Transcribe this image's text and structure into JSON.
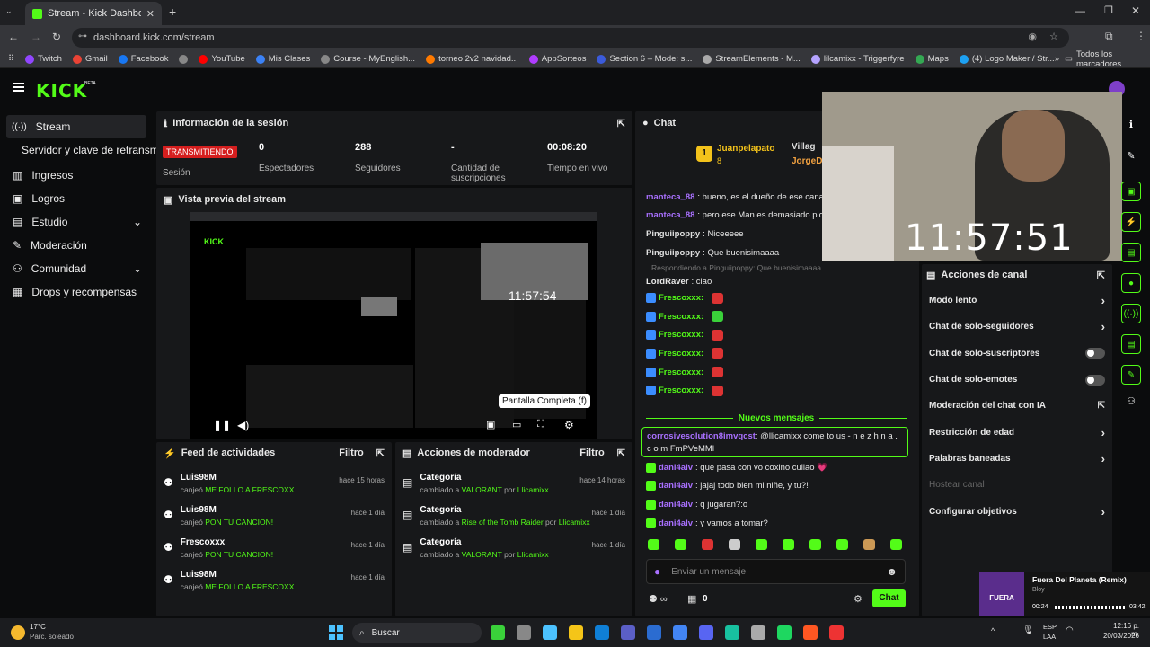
{
  "browser": {
    "tab_title": "Stream - Kick Dashboard",
    "url": "dashboard.kick.com/stream",
    "bookmarks": [
      "Twitch",
      "Gmail",
      "Facebook",
      "",
      "YouTube",
      "Mis Clases",
      "Course - MyEnglish...",
      "torneo 2v2 navidad...",
      "AppSorteos",
      "Section 6 – Mode: s...",
      "StreamElements - M...",
      "lilcamixx - Triggerfyre",
      "Maps",
      "(4) Logo Maker / Str..."
    ],
    "all_bookmarks": "Todos los marcadores"
  },
  "brand": {
    "logo": "KICK",
    "beta": "BETA"
  },
  "sidebar": {
    "items": [
      {
        "label": "Stream"
      },
      {
        "label": "Servidor y clave de retransmi"
      },
      {
        "label": "Ingresos"
      },
      {
        "label": "Logros"
      },
      {
        "label": "Estudio"
      },
      {
        "label": "Moderación"
      },
      {
        "label": "Comunidad"
      },
      {
        "label": "Drops y recompensas"
      }
    ]
  },
  "session": {
    "title": "Información de la sesión",
    "status": "TRANSMITIENDO",
    "status_label": "Sesión",
    "stats": [
      {
        "value": "0",
        "label": "Espectadores"
      },
      {
        "value": "288",
        "label": "Seguidores"
      },
      {
        "value": "-",
        "label": "Cantidad de suscripciones"
      },
      {
        "value": "00:08:20",
        "label": "Tiempo en vivo"
      }
    ]
  },
  "preview": {
    "title": "Vista previa del stream",
    "tooltip": "Pantalla Completa (f)",
    "inner_clock": "11:57:54"
  },
  "feed": {
    "title": "Feed de actividades",
    "filter": "Filtro",
    "items": [
      {
        "user": "Luis98M",
        "prefix": "canjeó ",
        "reward": "ME FOLLO A FRESCOXX",
        "time": "hace 15 horas"
      },
      {
        "user": "Luis98M",
        "prefix": "canjeó ",
        "reward": "PON TU CANCION!",
        "time": "hace 1 día"
      },
      {
        "user": "Frescoxxx",
        "prefix": "canjeó ",
        "reward": "PON TU CANCION!",
        "time": "hace 1 día"
      },
      {
        "user": "Luis98M",
        "prefix": "canjeó ",
        "reward": "ME FOLLO A FRESCOXX",
        "time": "hace 1 día"
      }
    ]
  },
  "mod": {
    "title": "Acciones de moderador",
    "filter": "Filtro",
    "items": [
      {
        "title": "Categoría",
        "pre": "cambiado a ",
        "cat": "VALORANT",
        "by": " por ",
        "user": "Llicamixx",
        "time": "hace 14 horas"
      },
      {
        "title": "Categoría",
        "pre": "cambiado a ",
        "cat": "Rise of the Tomb Raider",
        "by": " por ",
        "user": "Llicamixx",
        "time": "hace 1 día"
      },
      {
        "title": "Categoría",
        "pre": "cambiado a ",
        "cat": "VALORANT",
        "by": " por ",
        "user": "Llicamixx",
        "time": "hace 1 día"
      }
    ]
  },
  "chat": {
    "title": "Chat",
    "top1_rank": "1",
    "top1_user": "Juanpelapato",
    "top1_count": "8",
    "top2_user": "Villag",
    "top3_user": "JorgeD",
    "messages": [
      {
        "user": "manteca_88",
        "text": ": bueno, es el dueño de ese canal",
        "color": "#a970ff"
      },
      {
        "user": "manteca_88",
        "text": ": pero ese Man es demasiado picad",
        "color": "#a970ff"
      },
      {
        "user": "Pinguiipoppy",
        "text": ": Niceeeee",
        "color": "#e0e0e0"
      },
      {
        "user": "Pinguiipoppy",
        "text": ": Que buenisimaaaa",
        "color": "#e0e0e0"
      }
    ],
    "reply": "Respondiendo a Pinguiipoppy: Que buenisimaaaa",
    "lord_user": "LordRaver",
    "lord_text": ": ciao",
    "fresco_user": "Frescoxxx:",
    "new_messages": "Nuevos mensajes",
    "highlight_user": "corrosivesolution8imvqcst",
    "highlight_text": ": @llicamixx come to us - n e z h n a . c o m FmPVeMMl",
    "later": [
      {
        "user": "dani4alv",
        "text": ": que pasa con vo coxino culiao 💗"
      },
      {
        "user": "dani4alv",
        "text": ": jajaj todo bien mi niñe, y tu?!"
      },
      {
        "user": "dani4alv",
        "text": ": q jugaran?:o"
      },
      {
        "user": "dani4alv",
        "text": ": y vamos a tomar?"
      }
    ],
    "input_placeholder": "Enviar un mensaje",
    "points": "0",
    "send": "Chat"
  },
  "webcam": {
    "clock": "11:57:51"
  },
  "actions": {
    "title": "Acciones de canal",
    "items": [
      {
        "label": "Modo lento",
        "type": "arrow"
      },
      {
        "label": "Chat de solo-seguidores",
        "type": "arrow"
      },
      {
        "label": "Chat de solo-suscriptores",
        "type": "toggle"
      },
      {
        "label": "Chat de solo-emotes",
        "type": "toggle"
      },
      {
        "label": "Moderación del chat con IA",
        "type": "ext"
      },
      {
        "label": "Restricción de edad",
        "type": "arrow"
      },
      {
        "label": "Palabras baneadas",
        "type": "arrow"
      },
      {
        "label": "Hostear canal",
        "type": "none"
      },
      {
        "label": "Configurar objetivos",
        "type": "arrow"
      }
    ]
  },
  "music": {
    "title": "Fuera Del Planeta (Remix)",
    "artist": "Bloy",
    "elapsed": "00:24",
    "duration": "03:42",
    "art_text": "FUERA"
  },
  "taskbar": {
    "temp": "17°C",
    "weather": "Parc. soleado",
    "search": "Buscar",
    "lang": "ESP",
    "lang2": "LAA",
    "time": "12:16 p. m.",
    "date": "20/03/2026"
  }
}
